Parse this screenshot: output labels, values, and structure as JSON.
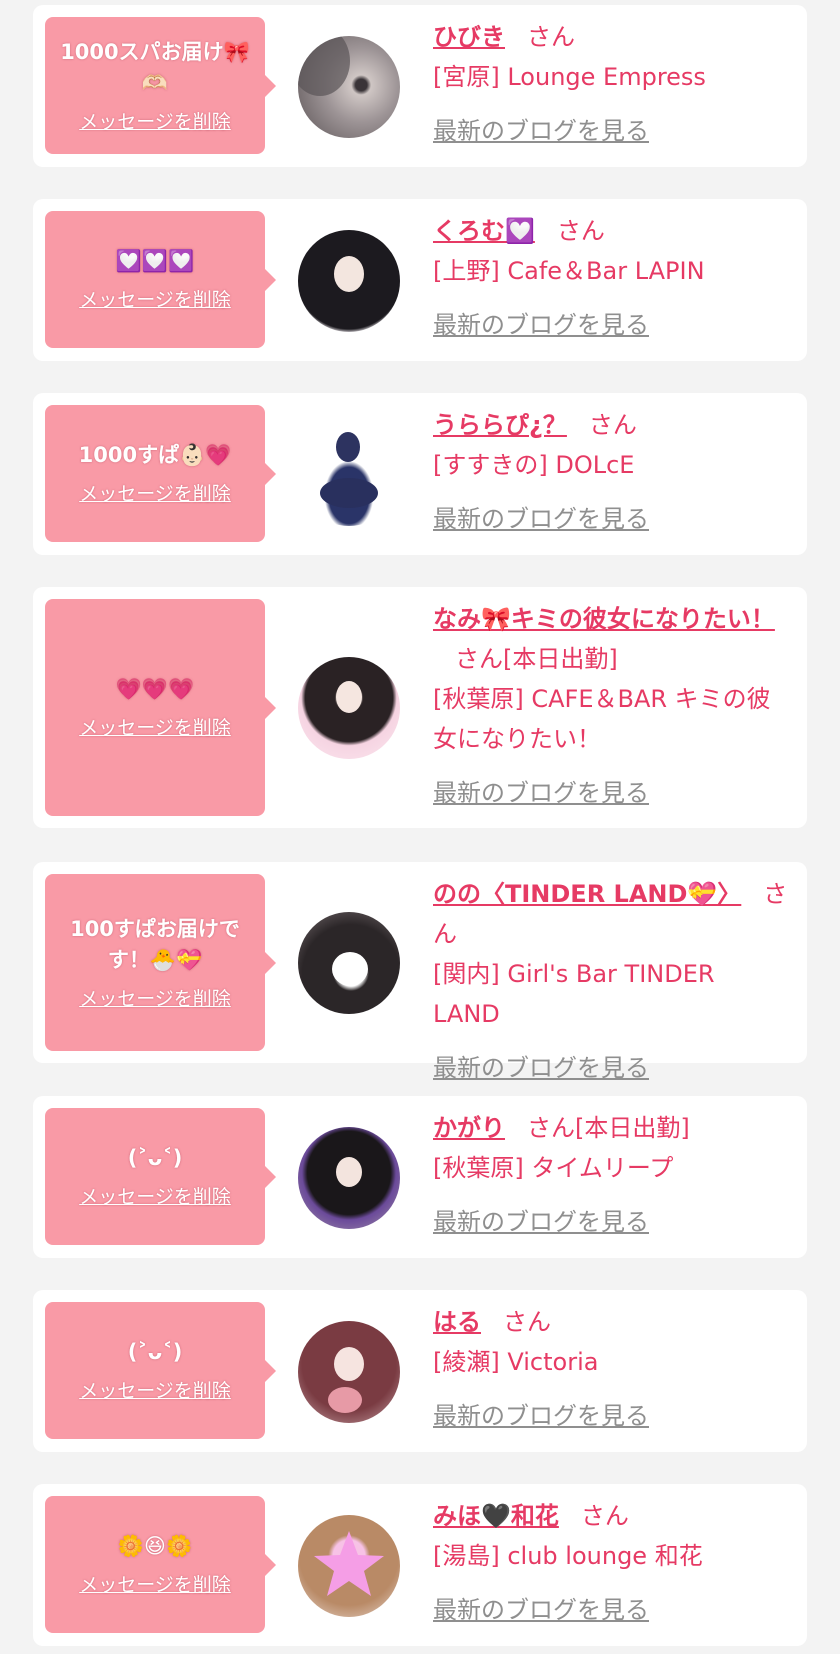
{
  "colors": {
    "accent": "#e63a64",
    "bubble": "#f99aa6",
    "link_gray": "#8f8f8f",
    "background": "#f3f3f3"
  },
  "items": [
    {
      "message": "1000スパお届け🎀🫶🏻",
      "delete_label": "メッセージを削除",
      "name": "ひびき",
      "suffix": "さん",
      "shop": "[宮原] Lounge Empress",
      "blog_label": "最新のブログを見る"
    },
    {
      "message": "💟💟💟",
      "delete_label": "メッセージを削除",
      "name": "くろむ💟",
      "suffix": "さん",
      "shop": "[上野] Cafe＆Bar LAPIN",
      "blog_label": "最新のブログを見る"
    },
    {
      "message": "1000すぱ👶🏻💗",
      "delete_label": "メッセージを削除",
      "name": "うららぴ¿？",
      "suffix": "さん",
      "shop": "[すすきの] DOLcE",
      "blog_label": "最新のブログを見る"
    },
    {
      "message": "💗💗💗",
      "delete_label": "メッセージを削除",
      "name": "なみ🎀キミの彼女になりたい！",
      "suffix": "さん[本日出勤]",
      "shop": "[秋葉原] CAFE＆BAR キミの彼女になりたい！",
      "blog_label": "最新のブログを見る"
    },
    {
      "message": "100すぱお届けです！🐣💝",
      "delete_label": "メッセージを削除",
      "name": "のの〈TINDER LAND💝〉",
      "suffix": "さん",
      "shop": "[関内] Girl's Bar TINDER LAND",
      "blog_label": "最新のブログを見る"
    },
    {
      "message": "(⁠˃⁠ᴗ⁠˂⁠)",
      "delete_label": "メッセージを削除",
      "name": "かがり",
      "suffix": "さん[本日出勤]",
      "shop": "[秋葉原] タイムリープ",
      "blog_label": "最新のブログを見る"
    },
    {
      "message": "(⁠˃⁠ᴗ⁠˂⁠)",
      "delete_label": "メッセージを削除",
      "name": "はる",
      "suffix": "さん",
      "shop": "[綾瀬] Victoria",
      "blog_label": "最新のブログを見る"
    },
    {
      "message": "🌼😆🌼",
      "delete_label": "メッセージを削除",
      "name": "みほ🖤和花",
      "suffix": "さん",
      "shop": "[湯島] club lounge 和花",
      "blog_label": "最新のブログを見る"
    }
  ]
}
